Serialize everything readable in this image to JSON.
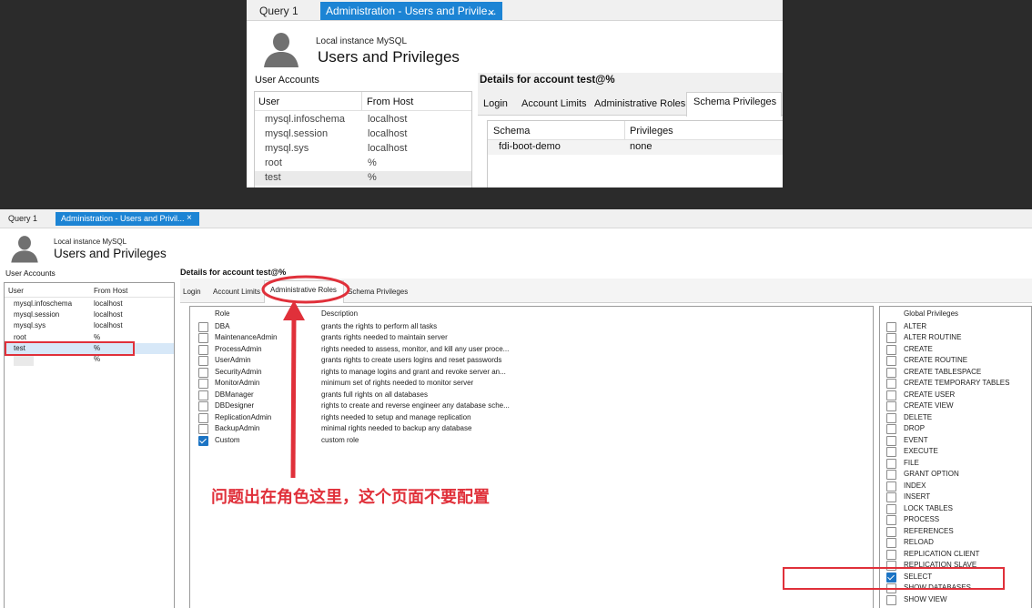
{
  "top": {
    "tabs": [
      {
        "label": "Query 1"
      },
      {
        "label": "Administration - Users and Privile..."
      }
    ],
    "close_glyph": "×",
    "header": {
      "subtitle": "Local instance MySQL",
      "title": "Users and Privileges"
    },
    "accounts_label": "User Accounts",
    "accounts_columns": [
      "User",
      "From Host"
    ],
    "accounts": [
      {
        "user": "mysql.infoschema",
        "host": "localhost"
      },
      {
        "user": "mysql.session",
        "host": "localhost"
      },
      {
        "user": "mysql.sys",
        "host": "localhost"
      },
      {
        "user": "root",
        "host": "%"
      },
      {
        "user": "test",
        "host": "%"
      }
    ],
    "details_title": "Details for account test@%",
    "detail_tabs": [
      "Login",
      "Account Limits",
      "Administrative Roles",
      "Schema Privileges"
    ],
    "schema_columns": [
      "Schema",
      "Privileges"
    ],
    "schema_rows": [
      {
        "schema": "fdi-boot-demo",
        "privileges": "none"
      }
    ]
  },
  "bottom": {
    "tabs": [
      {
        "label": "Query 1"
      },
      {
        "label": "Administration - Users and Privil..."
      }
    ],
    "close_glyph": "×",
    "header": {
      "subtitle": "Local instance MySQL",
      "title": "Users and Privileges"
    },
    "accounts_label": "User Accounts",
    "accounts_columns": [
      "User",
      "From Host"
    ],
    "accounts": [
      {
        "user": "mysql.infoschema",
        "host": "localhost"
      },
      {
        "user": "mysql.session",
        "host": "localhost"
      },
      {
        "user": "mysql.sys",
        "host": "localhost"
      },
      {
        "user": "root",
        "host": "%"
      },
      {
        "user": "test",
        "host": "%"
      },
      {
        "user": "",
        "host": "%"
      }
    ],
    "details_title": "Details for account test@%",
    "detail_tabs": [
      "Login",
      "Account Limits",
      "Administrative Roles",
      "Schema Privileges"
    ],
    "roles_columns": [
      "Role",
      "Description"
    ],
    "roles": [
      {
        "role": "DBA",
        "description": "grants the rights to perform all tasks",
        "checked": false
      },
      {
        "role": "MaintenanceAdmin",
        "description": "grants rights needed to maintain server",
        "checked": false
      },
      {
        "role": "ProcessAdmin",
        "description": "rights needed to assess, monitor, and kill any user proce...",
        "checked": false
      },
      {
        "role": "UserAdmin",
        "description": "grants rights to create users logins and reset passwords",
        "checked": false
      },
      {
        "role": "SecurityAdmin",
        "description": "rights to manage logins and grant and revoke server an...",
        "checked": false
      },
      {
        "role": "MonitorAdmin",
        "description": "minimum set of rights needed to monitor server",
        "checked": false
      },
      {
        "role": "DBManager",
        "description": "grants full rights on all databases",
        "checked": false
      },
      {
        "role": "DBDesigner",
        "description": "rights to create and reverse engineer any database sche...",
        "checked": false
      },
      {
        "role": "ReplicationAdmin",
        "description": "rights needed to setup and manage replication",
        "checked": false
      },
      {
        "role": "BackupAdmin",
        "description": "minimal rights needed to backup any database",
        "checked": false
      },
      {
        "role": "Custom",
        "description": "custom role",
        "checked": true
      }
    ],
    "global_privileges_title": "Global Privileges",
    "privileges": [
      {
        "name": "ALTER",
        "checked": false
      },
      {
        "name": "ALTER ROUTINE",
        "checked": false
      },
      {
        "name": "CREATE",
        "checked": false
      },
      {
        "name": "CREATE ROUTINE",
        "checked": false
      },
      {
        "name": "CREATE TABLESPACE",
        "checked": false
      },
      {
        "name": "CREATE TEMPORARY TABLES",
        "checked": false
      },
      {
        "name": "CREATE USER",
        "checked": false
      },
      {
        "name": "CREATE VIEW",
        "checked": false
      },
      {
        "name": "DELETE",
        "checked": false
      },
      {
        "name": "DROP",
        "checked": false
      },
      {
        "name": "EVENT",
        "checked": false
      },
      {
        "name": "EXECUTE",
        "checked": false
      },
      {
        "name": "FILE",
        "checked": false
      },
      {
        "name": "GRANT OPTION",
        "checked": false
      },
      {
        "name": "INDEX",
        "checked": false
      },
      {
        "name": "INSERT",
        "checked": false
      },
      {
        "name": "LOCK TABLES",
        "checked": false
      },
      {
        "name": "PROCESS",
        "checked": false
      },
      {
        "name": "REFERENCES",
        "checked": false
      },
      {
        "name": "RELOAD",
        "checked": false
      },
      {
        "name": "REPLICATION CLIENT",
        "checked": false
      },
      {
        "name": "REPLICATION SLAVE",
        "checked": false
      },
      {
        "name": "SELECT",
        "checked": true
      },
      {
        "name": "SHOW DATABASES",
        "checked": false
      },
      {
        "name": "SHOW VIEW",
        "checked": false
      }
    ],
    "annotation_text": "问题出在角色这里，这个页面不要配置",
    "colors": {
      "annotation": "#e0303a",
      "tab_active": "#1c84d4",
      "checkbox": "#1c74c4"
    }
  }
}
